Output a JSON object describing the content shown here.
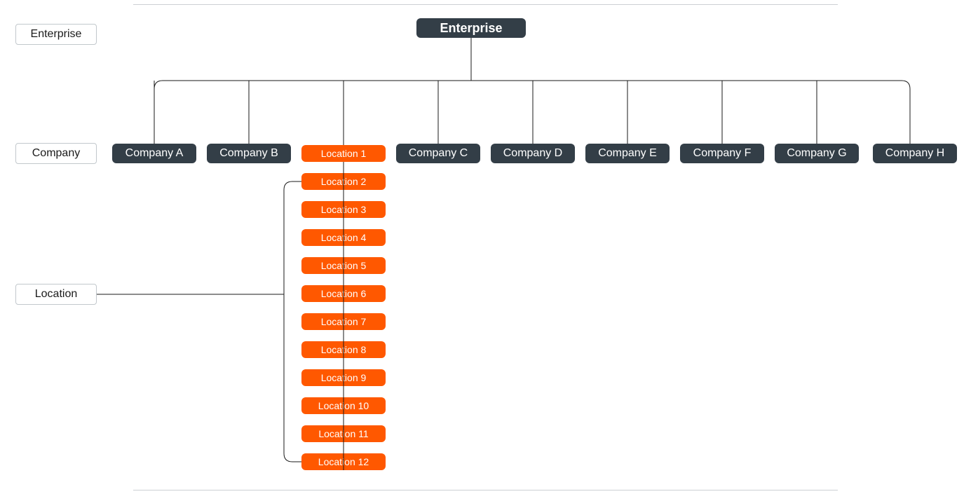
{
  "legend": {
    "enterprise": "Enterprise",
    "company": "Company",
    "location": "Location"
  },
  "enterprise": {
    "label": "Enterprise"
  },
  "companies": [
    {
      "label": "Company A"
    },
    {
      "label": "Company B"
    },
    {
      "label": "Company C"
    },
    {
      "label": "Company D"
    },
    {
      "label": "Company E"
    },
    {
      "label": "Company F"
    },
    {
      "label": "Company G"
    },
    {
      "label": "Company H"
    }
  ],
  "locations": [
    {
      "label": "Location 1"
    },
    {
      "label": "Location 2"
    },
    {
      "label": "Location 3"
    },
    {
      "label": "Location 4"
    },
    {
      "label": "Location 5"
    },
    {
      "label": "Location 6"
    },
    {
      "label": "Location 7"
    },
    {
      "label": "Location 8"
    },
    {
      "label": "Location 9"
    },
    {
      "label": "Location 10"
    },
    {
      "label": "Location 11"
    },
    {
      "label": "Location 12"
    }
  ],
  "colors": {
    "dark_node": "#333e47",
    "accent_node": "#ff5800",
    "border_light": "#c2c8cc"
  }
}
